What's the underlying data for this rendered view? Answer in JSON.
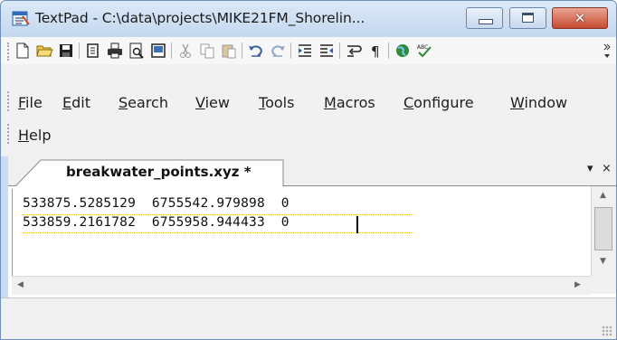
{
  "window": {
    "title": "TextPad - C:\\data\\projects\\MIKE21FM_Shorelin...",
    "close_label": "✕"
  },
  "toolbar": {
    "buttons": [
      "new-file-icon",
      "open-folder-icon",
      "save-icon",
      "save-all-icon",
      "print-icon",
      "print-preview-icon",
      "document-properties-icon",
      "cut-icon",
      "copy-icon",
      "paste-icon",
      "undo-icon",
      "redo-icon",
      "indent-icon",
      "outdent-icon",
      "word-wrap-icon",
      "pilcrow-icon",
      "web-icon",
      "spell-check-icon"
    ]
  },
  "menu": {
    "row1": [
      {
        "accel": "F",
        "rest": "ile"
      },
      {
        "accel": "E",
        "rest": "dit"
      },
      {
        "accel": "S",
        "rest": "earch"
      },
      {
        "accel": "V",
        "rest": "iew"
      },
      {
        "accel": "T",
        "rest": "ools"
      },
      {
        "accel": "M",
        "rest": "acros"
      },
      {
        "accel": "C",
        "rest": "onfigure"
      },
      {
        "accel": "W",
        "rest": "indow"
      }
    ],
    "row2": [
      {
        "accel": "H",
        "rest": "elp"
      }
    ]
  },
  "tab": {
    "label": "breakwater_points.xyz *",
    "dropdown": "▾",
    "close": "×"
  },
  "editor": {
    "lines": [
      "533875.5285129  6755542.979898  0",
      "533859.2161782  6755958.944433  0"
    ]
  },
  "colors": {
    "titlebar": "#c4d8f0",
    "close_button": "#c64a32",
    "dotted_line": "#e0c000"
  }
}
